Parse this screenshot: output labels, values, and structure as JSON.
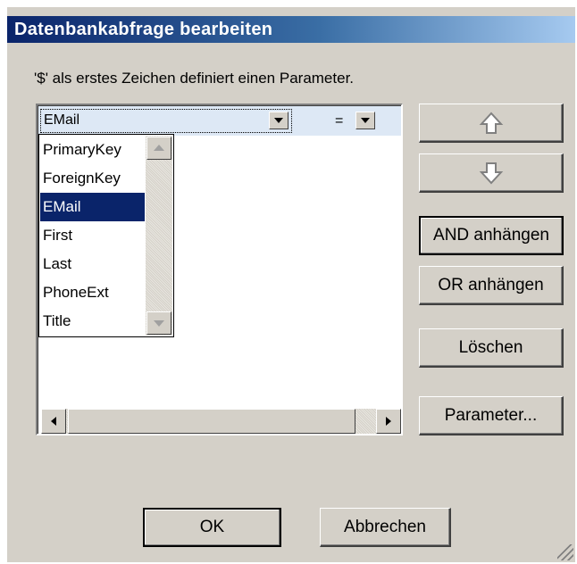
{
  "window": {
    "title": "Datenbankabfrage bearbeiten"
  },
  "hint": "'$' als erstes Zeichen definiert einen Parameter.",
  "criteria": {
    "field_value": "EMail",
    "operator_value": "="
  },
  "dropdown": {
    "items": [
      "PrimaryKey",
      "ForeignKey",
      "EMail",
      "First",
      "Last",
      "PhoneExt",
      "Title"
    ],
    "selected": "EMail"
  },
  "buttons": {
    "move_up_icon": "arrow-up-icon",
    "move_down_icon": "arrow-down-icon",
    "add_and": "AND anhängen",
    "add_or": "OR anhängen",
    "delete": "Löschen",
    "parameters": "Parameter...",
    "ok": "OK",
    "cancel": "Abbrechen"
  },
  "colors": {
    "title_start": "#0a246a",
    "title_end": "#a6caf0",
    "selection": "#0a246a",
    "row_highlight": "#dde8f5",
    "dialog_bg": "#d4d0c8"
  }
}
